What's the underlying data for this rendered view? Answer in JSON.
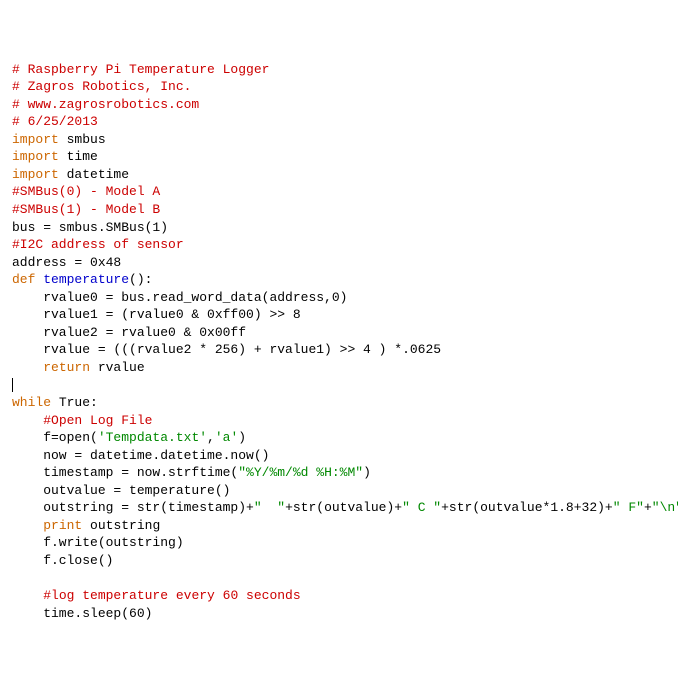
{
  "lines": [
    [
      {
        "t": "# Raspberry Pi Temperature Logger",
        "cls": "c"
      }
    ],
    [
      {
        "t": "# Zagros Robotics, Inc.",
        "cls": "c"
      }
    ],
    [
      {
        "t": "# www.zagrosrobotics.com",
        "cls": "c"
      }
    ],
    [
      {
        "t": "# 6/25/2013",
        "cls": "c"
      }
    ],
    [
      {
        "t": "",
        "cls": "n"
      }
    ],
    [
      {
        "t": "import",
        "cls": "k"
      },
      {
        "t": " smbus",
        "cls": "n"
      }
    ],
    [
      {
        "t": "import",
        "cls": "k"
      },
      {
        "t": " time",
        "cls": "n"
      }
    ],
    [
      {
        "t": "import",
        "cls": "k"
      },
      {
        "t": " datetime",
        "cls": "n"
      }
    ],
    [
      {
        "t": "",
        "cls": "n"
      }
    ],
    [
      {
        "t": "#SMBus(0) - Model A",
        "cls": "c"
      }
    ],
    [
      {
        "t": "#SMBus(1) - Model B",
        "cls": "c"
      }
    ],
    [
      {
        "t": "",
        "cls": "n"
      }
    ],
    [
      {
        "t": "bus = smbus.SMBus(1)",
        "cls": "n"
      }
    ],
    [
      {
        "t": "",
        "cls": "n"
      }
    ],
    [
      {
        "t": "#I2C address of sensor",
        "cls": "c"
      }
    ],
    [
      {
        "t": "address = 0x48",
        "cls": "n"
      }
    ],
    [
      {
        "t": "",
        "cls": "n"
      }
    ],
    [
      {
        "t": "def",
        "cls": "k"
      },
      {
        "t": " ",
        "cls": "n"
      },
      {
        "t": "temperature",
        "cls": "f"
      },
      {
        "t": "():",
        "cls": "n"
      }
    ],
    [
      {
        "t": "    rvalue0 = bus.read_word_data(address,0)",
        "cls": "n"
      }
    ],
    [
      {
        "t": "    rvalue1 = (rvalue0 & 0xff00) >> 8",
        "cls": "n"
      }
    ],
    [
      {
        "t": "    rvalue2 = rvalue0 & 0x00ff",
        "cls": "n"
      }
    ],
    [
      {
        "t": "    rvalue = (((rvalue2 * 256) + rvalue1) >> 4 ) *.0625",
        "cls": "n"
      }
    ],
    [
      {
        "t": "    ",
        "cls": "n"
      },
      {
        "t": "return",
        "cls": "k"
      },
      {
        "t": " rvalue",
        "cls": "n"
      }
    ],
    [
      {
        "t": "",
        "cls": "n"
      }
    ],
    [
      {
        "t": "|CURSOR|",
        "cls": "n"
      }
    ],
    [
      {
        "t": "while",
        "cls": "k"
      },
      {
        "t": " True:",
        "cls": "n"
      }
    ],
    [
      {
        "t": "",
        "cls": "n"
      }
    ],
    [
      {
        "t": "    ",
        "cls": "n"
      },
      {
        "t": "#Open Log File",
        "cls": "c"
      }
    ],
    [
      {
        "t": "    f=open(",
        "cls": "n"
      },
      {
        "t": "'Tempdata.txt'",
        "cls": "s"
      },
      {
        "t": ",",
        "cls": "n"
      },
      {
        "t": "'a'",
        "cls": "s"
      },
      {
        "t": ")",
        "cls": "n"
      }
    ],
    [
      {
        "t": "    now = datetime.datetime.now()",
        "cls": "n"
      }
    ],
    [
      {
        "t": "    timestamp = now.strftime(",
        "cls": "n"
      },
      {
        "t": "\"%Y/%m/%d %H:%M\"",
        "cls": "s"
      },
      {
        "t": ")",
        "cls": "n"
      }
    ],
    [
      {
        "t": "    outvalue = temperature()",
        "cls": "n"
      }
    ],
    [
      {
        "t": "    outstring = str(timestamp)+",
        "cls": "n"
      },
      {
        "t": "\"  \"",
        "cls": "s"
      },
      {
        "t": "+str(outvalue)+",
        "cls": "n"
      },
      {
        "t": "\" C \"",
        "cls": "s"
      },
      {
        "t": "+str(outvalue*1.8+32)+",
        "cls": "n"
      },
      {
        "t": "\" F\"",
        "cls": "s"
      },
      {
        "t": "+",
        "cls": "n"
      },
      {
        "t": "\"\\n\"",
        "cls": "s"
      }
    ],
    [
      {
        "t": "    ",
        "cls": "n"
      },
      {
        "t": "print",
        "cls": "k"
      },
      {
        "t": " outstring",
        "cls": "n"
      }
    ],
    [
      {
        "t": "    f.write(outstring)",
        "cls": "n"
      }
    ],
    [
      {
        "t": "    f.close()",
        "cls": "n"
      }
    ],
    [
      {
        "t": "    ",
        "cls": "n"
      }
    ],
    [
      {
        "t": "    ",
        "cls": "n"
      },
      {
        "t": "#log temperature every 60 seconds",
        "cls": "c"
      }
    ],
    [
      {
        "t": "    time.sleep(60)",
        "cls": "n"
      }
    ]
  ]
}
